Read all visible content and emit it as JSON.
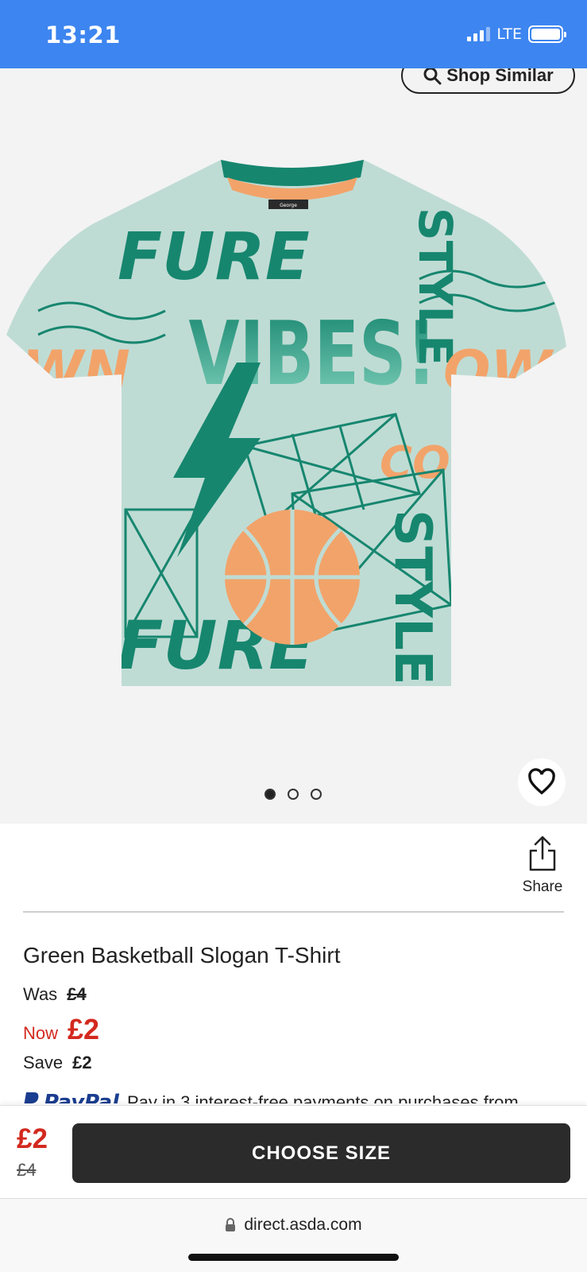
{
  "status_bar": {
    "time": "13:21",
    "network": "LTE",
    "signal_bars": 3,
    "battery_level": 1.0
  },
  "product_gallery": {
    "shop_similar_label": "Shop Similar",
    "image_count": 3,
    "active_image": 0,
    "shirt_brand_label": "George",
    "shirt_print_words": [
      "FUTURE",
      "VIBES!",
      "STYLE",
      "OWN",
      "COURT"
    ],
    "colors": {
      "shirt_base": "#bfdcd4",
      "print_green": "#17866f",
      "print_orange": "#f2a36a"
    }
  },
  "share": {
    "label": "Share"
  },
  "product": {
    "title": "Green Basketball Slogan T-Shirt",
    "was_label": "Was",
    "was_price": "£4",
    "now_label": "Now",
    "now_price": "£2",
    "save_label": "Save",
    "save_amount": "£2"
  },
  "paypal": {
    "brand": "PayPal",
    "text": "Pay in 3 interest-free payments on purchases from"
  },
  "bottom_bar": {
    "now_price": "£2",
    "was_price": "£4",
    "cta_label": "CHOOSE SIZE"
  },
  "browser": {
    "url": "direct.asda.com"
  },
  "theme": {
    "status_bar_bg": "#3d85f0",
    "sale_red": "#d3291f",
    "cta_bg": "#2b2b2b"
  }
}
